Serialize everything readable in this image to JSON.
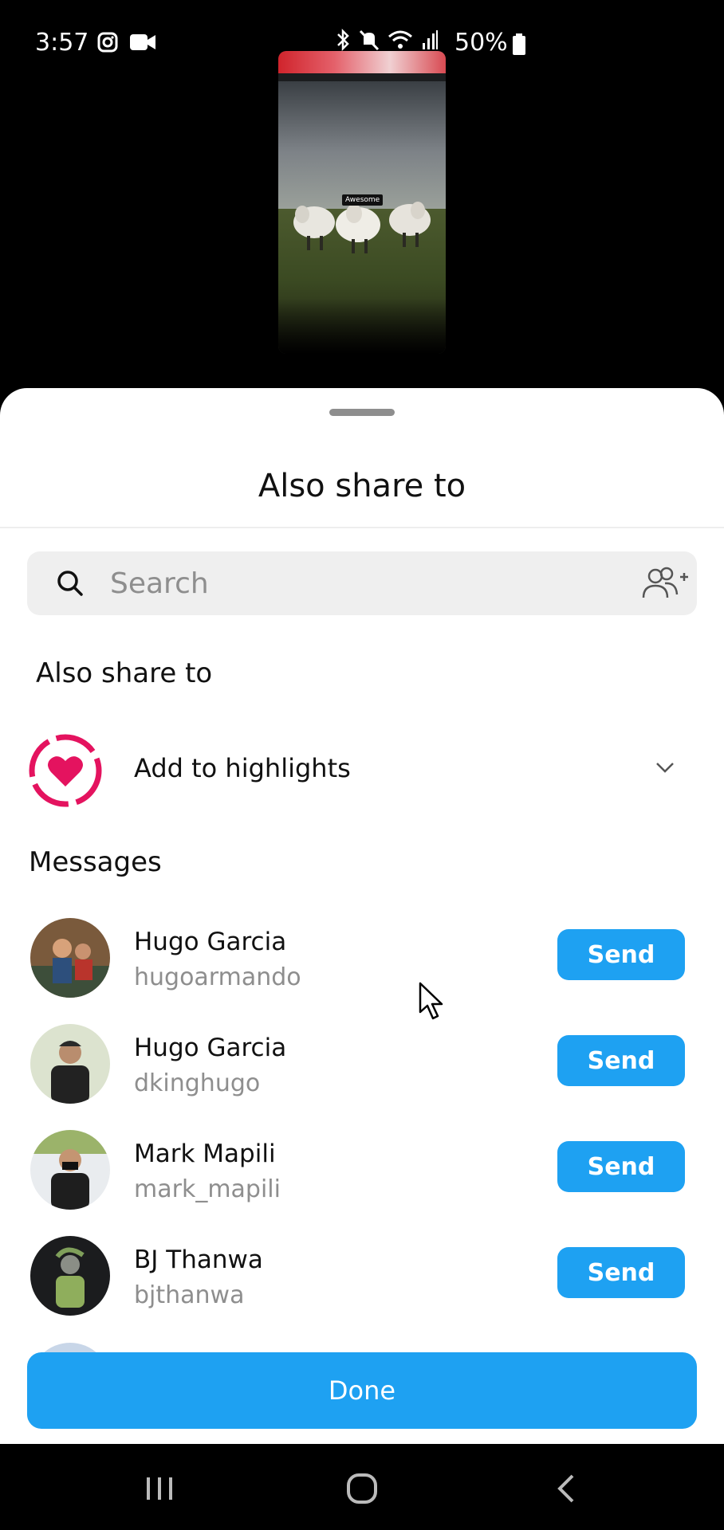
{
  "status_bar": {
    "time": "3:57",
    "battery": "50%",
    "icons": [
      "instagram-icon",
      "video-call-icon",
      "bluetooth-icon",
      "mute-icon",
      "wifi-icon",
      "signal-icon",
      "battery-icon"
    ]
  },
  "story_preview": {
    "sticker_text": "Awesome"
  },
  "sheet": {
    "title": "Also share to",
    "search": {
      "placeholder": "Search",
      "value": ""
    },
    "also_share_label": "Also share to",
    "highlights": {
      "label": "Add to highlights"
    },
    "messages_label": "Messages",
    "contacts": [
      {
        "name": "Hugo Garcia",
        "username": "hugoarmando",
        "button": "Send"
      },
      {
        "name": "Hugo Garcia",
        "username": "dkinghugo",
        "button": "Send"
      },
      {
        "name": "Mark Mapili",
        "username": "mark_mapili",
        "button": "Send"
      },
      {
        "name": "BJ Thanwa",
        "username": "bjthanwa",
        "button": "Send"
      }
    ],
    "done_label": "Done"
  },
  "colors": {
    "accent_blue": "#1ea1f2",
    "highlight_pink": "#e4135f"
  }
}
